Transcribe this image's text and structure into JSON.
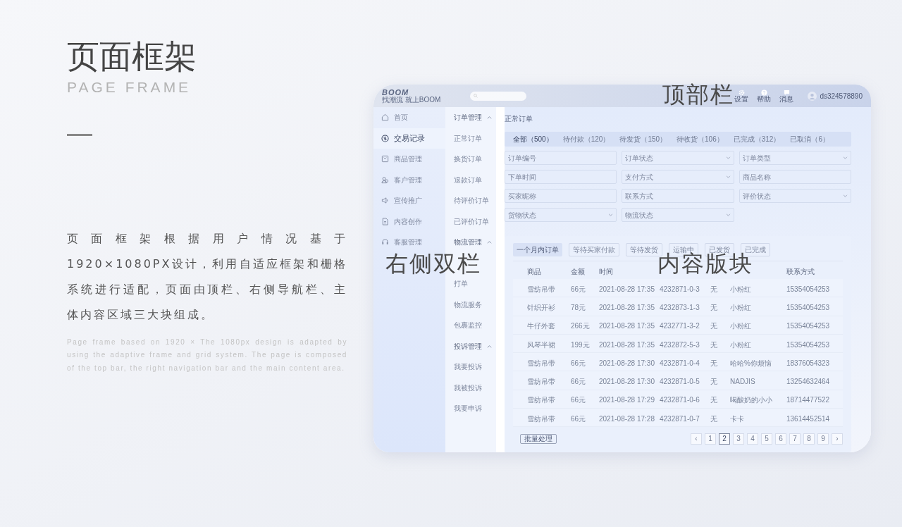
{
  "slide": {
    "title": "页面框架",
    "subtitle": "PAGE FRAME",
    "body_cn": "页 面 框 架 根 据 用 户 情 况 基 于 1920×1080PX设计，利用自适应框架和栅格系统进行适配，页面由顶栏、右侧导航栏、主体内容区域三大块组成。",
    "body_en": "Page frame based on 1920 × The 1080px design is adapted by using the adaptive frame and grid system. The page is composed of the top bar, the right navigation bar and the main content area."
  },
  "annotations": [
    {
      "kind": "top",
      "text": "顶部栏"
    },
    {
      "kind": "nav",
      "text": "右侧双栏"
    },
    {
      "kind": "content",
      "text": "内容版块"
    }
  ],
  "top_bar": {
    "logo": "BOOM",
    "slogan": "找潮流 就上BOOM",
    "actions": [
      {
        "kind": "settings",
        "label": "设置"
      },
      {
        "kind": "help",
        "label": "帮助"
      },
      {
        "kind": "message",
        "label": "消息"
      }
    ],
    "user": "ds324578890"
  },
  "nav": [
    {
      "kind": "home",
      "label": "首页",
      "selected": false
    },
    {
      "kind": "money",
      "label": "交易记录",
      "selected": true
    },
    {
      "kind": "goods",
      "label": "商品管理",
      "selected": false
    },
    {
      "kind": "customer",
      "label": "客户管理",
      "selected": false
    },
    {
      "kind": "promo",
      "label": "宣传推广",
      "selected": false
    },
    {
      "kind": "content",
      "label": "内容创作",
      "selected": false
    },
    {
      "kind": "service",
      "label": "客服管理",
      "selected": false
    }
  ],
  "subnav": [
    {
      "label": "订单管理",
      "expanded": true,
      "children": [
        {
          "label": "正常订单"
        },
        {
          "label": "换货订单"
        },
        {
          "label": "退款订单"
        },
        {
          "label": "待评价订单"
        },
        {
          "label": "已评价订单"
        }
      ]
    },
    {
      "label": "物流管理",
      "expanded": true,
      "children": [
        {
          "label": "打单"
        },
        {
          "label": "物流服务"
        },
        {
          "label": "包裹监控"
        }
      ]
    },
    {
      "label": "投诉管理",
      "expanded": true,
      "children": [
        {
          "label": "我要投诉"
        },
        {
          "label": "我被投诉"
        },
        {
          "label": "我要申诉"
        }
      ]
    }
  ],
  "content": {
    "title": "正常订单",
    "tabs": [
      {
        "label": "全部（500）",
        "selected": true
      },
      {
        "label": "待付款（120）",
        "selected": false
      },
      {
        "label": "待发货（150）",
        "selected": false
      },
      {
        "label": "待收货（106）",
        "selected": false
      },
      {
        "label": "已完成（312）",
        "selected": false
      },
      {
        "label": "已取消（6）",
        "selected": false
      }
    ],
    "filters": [
      {
        "kind": "input",
        "placeholder": "订单编号"
      },
      {
        "kind": "select",
        "placeholder": "订单状态"
      },
      {
        "kind": "select",
        "placeholder": "订单类型"
      },
      {
        "kind": "input",
        "placeholder": "下单时间"
      },
      {
        "kind": "select",
        "placeholder": "支付方式"
      },
      {
        "kind": "input",
        "placeholder": "商品名称"
      },
      {
        "kind": "input",
        "placeholder": "买家昵称"
      },
      {
        "kind": "input",
        "placeholder": "联系方式"
      },
      {
        "kind": "select",
        "placeholder": "评价状态"
      },
      {
        "kind": "select",
        "placeholder": "货物状态"
      },
      {
        "kind": "select",
        "placeholder": "物流状态"
      }
    ],
    "chips": [
      {
        "label": "一个月内订单",
        "selected": true
      },
      {
        "label": "等待买家付款",
        "selected": false
      },
      {
        "label": "等待发货",
        "selected": false
      },
      {
        "label": "运输中",
        "selected": false
      },
      {
        "label": "已发货",
        "selected": false
      },
      {
        "label": "已完成",
        "selected": false
      }
    ],
    "columns": [
      {
        "label": "商品"
      },
      {
        "label": "金额"
      },
      {
        "label": "时间"
      },
      {},
      {},
      {},
      {
        "label": "联系方式"
      }
    ],
    "rows": [
      [
        "雪纺吊带",
        "66元",
        "2021-08-28 17:35",
        "4232871-0-3",
        "无",
        "小粉红",
        "15354054253"
      ],
      [
        "针织开衫",
        "78元",
        "2021-08-28 17:35",
        "4232873-1-3",
        "无",
        "小粉红",
        "15354054253"
      ],
      [
        "牛仔外套",
        "266元",
        "2021-08-28 17:35",
        "4232771-3-2",
        "无",
        "小粉红",
        "15354054253"
      ],
      [
        "风琴半裙",
        "199元",
        "2021-08-28 17:35",
        "4232872-5-3",
        "无",
        "小粉红",
        "15354054253"
      ],
      [
        "雪纺吊带",
        "66元",
        "2021-08-28 17:30",
        "4232871-0-4",
        "无",
        "哈哈%你烦恼",
        "18376054323"
      ],
      [
        "雪纺吊带",
        "66元",
        "2021-08-28 17:30",
        "4232871-0-5",
        "无",
        "NADJIS",
        "13254632464"
      ],
      [
        "雪纺吊带",
        "66元",
        "2021-08-28 17:29",
        "4232871-0-6",
        "无",
        "喝酸奶的小小",
        "18714477522"
      ],
      [
        "雪纺吊带",
        "66元",
        "2021-08-28 17:28",
        "4232871-0-7",
        "无",
        "卡卡",
        "13614452514"
      ]
    ],
    "batch_button": "批量处理",
    "pages": [
      {
        "label": "‹",
        "selected": false
      },
      {
        "label": "1",
        "selected": false
      },
      {
        "label": "2",
        "selected": true
      },
      {
        "label": "3",
        "selected": false
      },
      {
        "label": "4",
        "selected": false
      },
      {
        "label": "5",
        "selected": false
      },
      {
        "label": "6",
        "selected": false
      },
      {
        "label": "7",
        "selected": false
      },
      {
        "label": "8",
        "selected": false
      },
      {
        "label": "9",
        "selected": false
      },
      {
        "label": "›",
        "selected": false
      }
    ]
  }
}
